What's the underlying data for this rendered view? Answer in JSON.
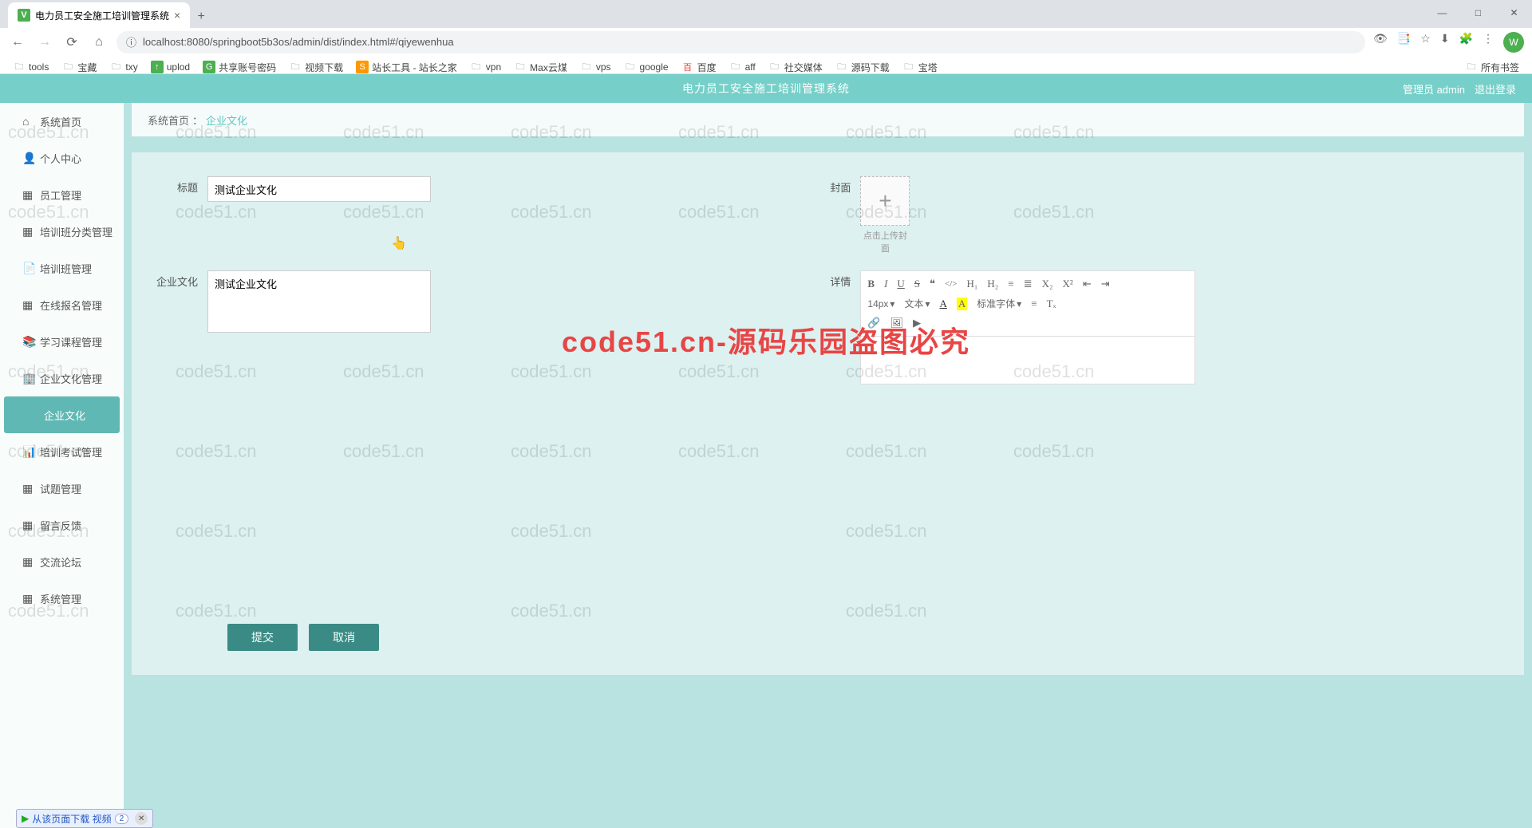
{
  "browser": {
    "tab_title": "电力员工安全施工培训管理系统",
    "new_tab": "+",
    "url": "localhost:8080/springboot5b3os/admin/dist/index.html#/qiyewenhua",
    "bookmarks": [
      "tools",
      "宝藏",
      "txy",
      "uplod",
      "共享账号密码",
      "视频下载",
      "站长工具 - 站长之家",
      "vpn",
      "Max云煤",
      "vps",
      "google",
      "百度",
      "aff",
      "社交媒体",
      "源码下载",
      "宝塔"
    ],
    "all_bookmarks": "所有书签",
    "win": {
      "min": "—",
      "max": "□",
      "close": "✕"
    },
    "avatar": "W"
  },
  "app": {
    "title": "电力员工安全施工培训管理系统",
    "admin_label": "管理员 admin",
    "logout": "退出登录"
  },
  "sidebar": {
    "items": [
      {
        "icon": "⌂",
        "label": "系统首页"
      },
      {
        "icon": "👤",
        "label": "个人中心"
      },
      {
        "icon": "▦",
        "label": "员工管理"
      },
      {
        "icon": "▦",
        "label": "培训班分类管理"
      },
      {
        "icon": "📄",
        "label": "培训班管理"
      },
      {
        "icon": "▦",
        "label": "在线报名管理"
      },
      {
        "icon": "📚",
        "label": "学习课程管理"
      },
      {
        "icon": "🏢",
        "label": "企业文化管理"
      },
      {
        "icon": "",
        "label": "企业文化"
      },
      {
        "icon": "📊",
        "label": "培训考试管理"
      },
      {
        "icon": "▦",
        "label": "试题管理"
      },
      {
        "icon": "▦",
        "label": "留言反馈"
      },
      {
        "icon": "▦",
        "label": "交流论坛"
      },
      {
        "icon": "▦",
        "label": "系统管理"
      }
    ]
  },
  "breadcrumb": {
    "home": "系统首页",
    "sep": "：",
    "current": "企业文化"
  },
  "form": {
    "title_label": "标题",
    "title_value": "测试企业文化",
    "cover_label": "封面",
    "upload_hint": "点击上传封面",
    "culture_label": "企业文化",
    "culture_value": "测试企业文化",
    "detail_label": "详情",
    "font_size": "14px",
    "font_family": "文本",
    "font_label": "标准字体",
    "submit": "提交",
    "cancel": "取消",
    "rich_placeholder": ""
  },
  "toolbar": {
    "bold": "B",
    "italic": "I",
    "underline": "U",
    "strike": "S",
    "quote": "❝",
    "code": "</>",
    "h1": "H₁",
    "h2": "H₂",
    "ol": "≡",
    "ul": "≣",
    "sub": "X₂",
    "sup": "X²",
    "indent_out": "⇤",
    "indent_in": "⇥",
    "color": "A",
    "bg": "A",
    "align": "≡",
    "clear": "Tₓ",
    "link": "🔗",
    "image": "🖼",
    "video": "▶"
  },
  "watermark": {
    "main": "code51.cn-源码乐园盗图必究",
    "small": "code51.cn"
  },
  "download_bar": {
    "text": "从该页面下载 视频",
    "count": "2"
  }
}
